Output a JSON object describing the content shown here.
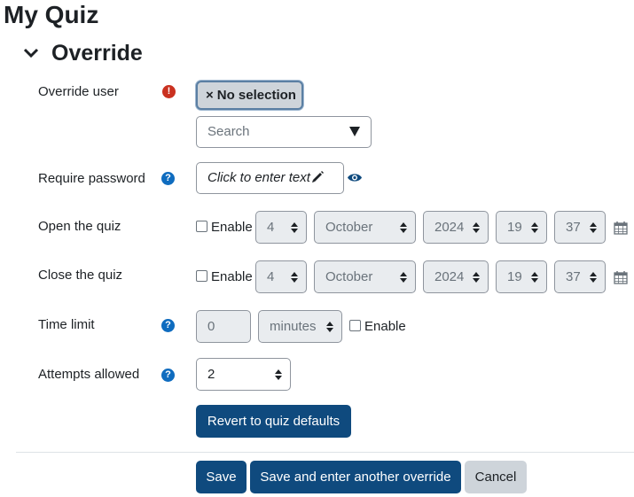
{
  "page": {
    "title": "My Quiz"
  },
  "section": {
    "title": "Override"
  },
  "fields": {
    "override_user": {
      "label": "Override user",
      "selection": "No selection",
      "remove_symbol": "×",
      "search_placeholder": "Search"
    },
    "require_password": {
      "label": "Require password",
      "placeholder": "Click to enter text"
    },
    "open_quiz": {
      "label": "Open the quiz",
      "enable_label": "Enable",
      "day": "4",
      "month": "October",
      "year": "2024",
      "hour": "19",
      "minute": "37"
    },
    "close_quiz": {
      "label": "Close the quiz",
      "enable_label": "Enable",
      "day": "4",
      "month": "October",
      "year": "2024",
      "hour": "19",
      "minute": "37"
    },
    "time_limit": {
      "label": "Time limit",
      "value": "0",
      "unit": "minutes",
      "enable_label": "Enable"
    },
    "attempts": {
      "label": "Attempts allowed",
      "value": "2"
    }
  },
  "buttons": {
    "revert": "Revert to quiz defaults",
    "save": "Save",
    "save_another": "Save and enter another override",
    "cancel": "Cancel"
  },
  "colors": {
    "primary": "#0f4a7e",
    "help": "#0f6cbf",
    "error": "#ca3120"
  }
}
